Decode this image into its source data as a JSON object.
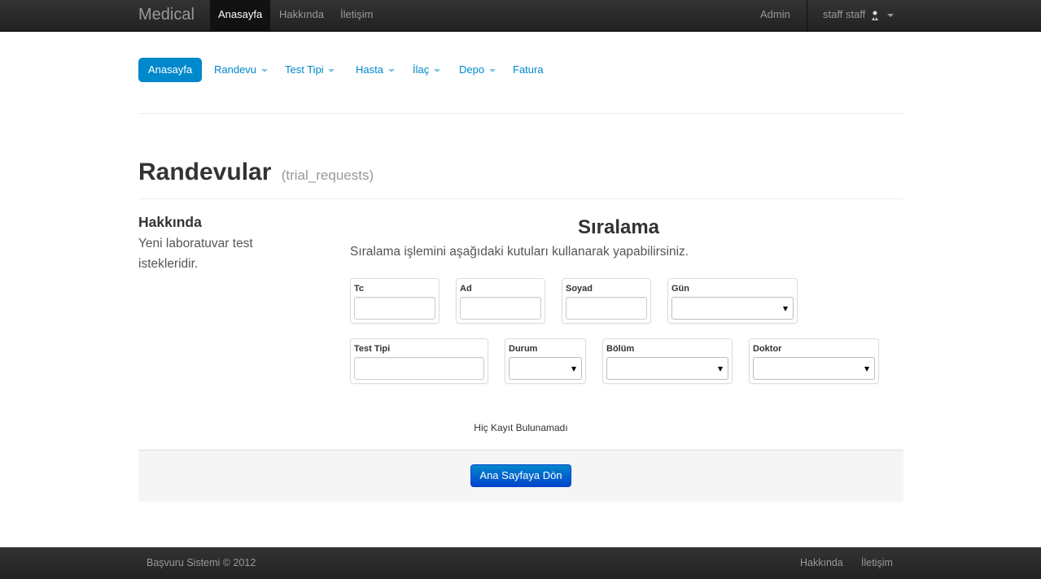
{
  "topbar": {
    "brand": "Medical",
    "links": [
      {
        "label": "Anasayfa",
        "active": true
      },
      {
        "label": "Hakkında",
        "active": false
      },
      {
        "label": "İletişim",
        "active": false
      }
    ],
    "admin_label": "Admin",
    "user_label": "staff staff"
  },
  "pills": [
    {
      "label": "Anasayfa",
      "active": true,
      "dropdown": false
    },
    {
      "label": "Randevu",
      "active": false,
      "dropdown": true
    },
    {
      "label": "Test Tipi",
      "active": false,
      "dropdown": true
    },
    {
      "label": "Hasta",
      "active": false,
      "dropdown": true
    },
    {
      "label": "İlaç",
      "active": false,
      "dropdown": true
    },
    {
      "label": "Depo",
      "active": false,
      "dropdown": true
    },
    {
      "label": "Fatura",
      "active": false,
      "dropdown": false
    }
  ],
  "header": {
    "title": "Randevular",
    "subtitle": "(trial_requests)"
  },
  "about": {
    "title": "Hakkında",
    "text": "Yeni laboratuvar test istekleridir."
  },
  "sorting": {
    "title": "Sıralama",
    "description": "Sıralama işlemini aşağıdaki kutuları kullanarak yapabilirsiniz.",
    "fields": [
      {
        "label": "Tc",
        "type": "text",
        "value": ""
      },
      {
        "label": "Ad",
        "type": "text",
        "value": ""
      },
      {
        "label": "Soyad",
        "type": "text",
        "value": ""
      },
      {
        "label": "Gün",
        "type": "select",
        "value": ""
      },
      {
        "label": "Test Tipi",
        "type": "text",
        "value": ""
      },
      {
        "label": "Durum",
        "type": "select",
        "value": ""
      },
      {
        "label": "Bölüm",
        "type": "select",
        "value": ""
      },
      {
        "label": "Doktor",
        "type": "select",
        "value": ""
      }
    ]
  },
  "no_records": "Hiç Kayıt Bulunamadı",
  "back_button": "Ana Sayfaya Dön",
  "footer": {
    "copyright": "Başvuru Sistemi © 2012",
    "links": [
      "Hakkında",
      "İletişim"
    ]
  },
  "colors": {
    "accent": "#0088cc",
    "navbar": "#222222"
  }
}
